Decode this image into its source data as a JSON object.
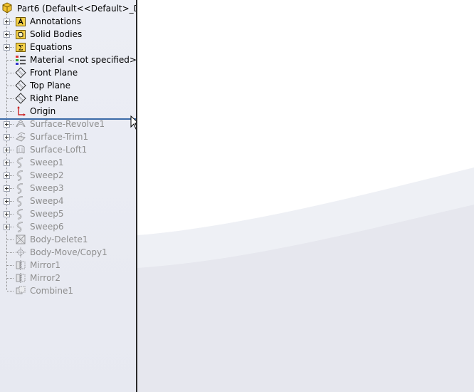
{
  "tree": {
    "root_label": "Part6  (Default<<Default>_Dis",
    "items": [
      {
        "label": "Annotations",
        "icon": "annotations-icon",
        "expandable": true,
        "suppressed": false
      },
      {
        "label": "Solid Bodies",
        "icon": "solid-bodies-icon",
        "expandable": true,
        "suppressed": false
      },
      {
        "label": "Equations",
        "icon": "equations-icon",
        "expandable": true,
        "suppressed": false
      },
      {
        "label": "Material <not specified>",
        "icon": "material-icon",
        "expandable": false,
        "suppressed": false
      },
      {
        "label": "Front Plane",
        "icon": "plane-icon",
        "expandable": false,
        "suppressed": false
      },
      {
        "label": "Top Plane",
        "icon": "plane-icon",
        "expandable": false,
        "suppressed": false
      },
      {
        "label": "Right Plane",
        "icon": "plane-icon",
        "expandable": false,
        "suppressed": false
      },
      {
        "label": "Origin",
        "icon": "origin-icon",
        "expandable": false,
        "suppressed": false
      },
      {
        "label": "Surface-Revolve1",
        "icon": "surface-revolve-icon",
        "expandable": true,
        "suppressed": true
      },
      {
        "label": "Surface-Trim1",
        "icon": "surface-trim-icon",
        "expandable": true,
        "suppressed": true
      },
      {
        "label": "Surface-Loft1",
        "icon": "surface-loft-icon",
        "expandable": true,
        "suppressed": true
      },
      {
        "label": "Sweep1",
        "icon": "sweep-icon",
        "expandable": true,
        "suppressed": true
      },
      {
        "label": "Sweep2",
        "icon": "sweep-icon",
        "expandable": true,
        "suppressed": true
      },
      {
        "label": "Sweep3",
        "icon": "sweep-icon",
        "expandable": true,
        "suppressed": true
      },
      {
        "label": "Sweep4",
        "icon": "sweep-icon",
        "expandable": true,
        "suppressed": true
      },
      {
        "label": "Sweep5",
        "icon": "sweep-icon",
        "expandable": true,
        "suppressed": true
      },
      {
        "label": "Sweep6",
        "icon": "sweep-icon",
        "expandable": true,
        "suppressed": true
      },
      {
        "label": "Body-Delete1",
        "icon": "body-delete-icon",
        "expandable": false,
        "suppressed": true
      },
      {
        "label": "Body-Move/Copy1",
        "icon": "body-move-icon",
        "expandable": false,
        "suppressed": true
      },
      {
        "label": "Mirror1",
        "icon": "mirror-icon",
        "expandable": false,
        "suppressed": true
      },
      {
        "label": "Mirror2",
        "icon": "mirror-icon",
        "expandable": false,
        "suppressed": true
      },
      {
        "label": "Combine1",
        "icon": "combine-icon",
        "expandable": false,
        "suppressed": true
      }
    ]
  },
  "colors": {
    "panel_bg": "#e9ebf3",
    "suppressed_text": "#8e8e8e",
    "rollback_bar": "#3b6aa8",
    "viewport_swoosh": "#e8e9ef"
  }
}
